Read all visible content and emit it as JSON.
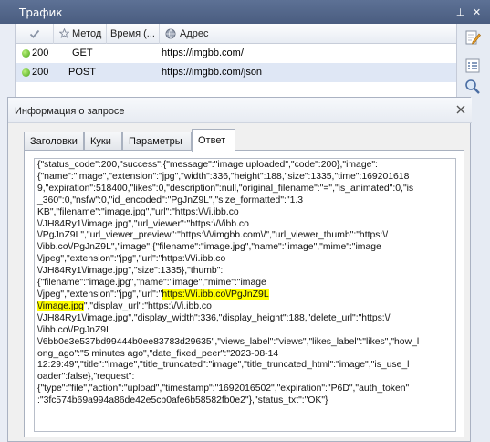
{
  "window": {
    "title": "Трафик",
    "pin_glyph": "⊥",
    "close_glyph": "✕"
  },
  "table": {
    "columns": [
      "",
      "Метод",
      "Время (...",
      "Адрес"
    ],
    "rows": [
      {
        "status": "200",
        "method": "GET",
        "address": "https://imgbb.com/"
      },
      {
        "status": "200",
        "method": "POST",
        "address": "https://imgbb.com/json"
      }
    ]
  },
  "dialog": {
    "title": "Информация о запросе",
    "tabs": [
      "Заголовки",
      "Куки",
      "Параметры",
      "Ответ"
    ],
    "active_tab": "Ответ",
    "response_lines": [
      {
        "t": "{\"status_code\":200,\"success\":{\"message\":\"image uploaded\",\"code\":200},\"image\":"
      },
      {
        "t": "{\"name\":\"image\",\"extension\":\"jpg\",\"width\":336,\"height\":188,\"size\":1335,\"time\":169201618"
      },
      {
        "t": "9,\"expiration\":518400,\"likes\":0,\"description\":null,\"original_filename\":\"=\",\"is_animated\":0,\"is"
      },
      {
        "t": "_360\":0,\"nsfw\":0,\"id_encoded\":\"PgJnZ9L\",\"size_formatted\":\"1.3"
      },
      {
        "t": "KB\",\"filename\":\"image.jpg\",\"url\":\"https:\\/\\/i.ibb.co"
      },
      {
        "t": "\\/JH84Ry1\\/image.jpg\",\"url_viewer\":\"https:\\/\\/ibb.co"
      },
      {
        "t": "\\/PgJnZ9L\",\"url_viewer_preview\":\"https:\\/\\/imgbb.com\\/\",\"url_viewer_thumb\":\"https:\\/"
      },
      {
        "t": "\\/ibb.co\\/PgJnZ9L\",\"image\":{\"filename\":\"image.jpg\",\"name\":\"image\",\"mime\":\"image"
      },
      {
        "t": "\\/jpeg\",\"extension\":\"jpg\",\"url\":\"https:\\/\\/i.ibb.co"
      },
      {
        "t": "\\/JH84Ry1\\/image.jpg\",\"size\":1335},\"thumb\":"
      },
      {
        "t": "{\"filename\":\"image.jpg\",\"name\":\"image\",\"mime\":\"image"
      },
      {
        "t": "\\/jpeg\",\"extension\":\"jpg\",\"url\":\"",
        "h": "https:\\/\\/i.ibb.co\\/PgJnZ9L"
      },
      {
        "h": "\\/image.jpg",
        "t": "\",\"display_url\":\"https:\\/\\/i.ibb.co"
      },
      {
        "t": "\\/JH84Ry1\\/image.jpg\",\"display_width\":336,\"display_height\":188,\"delete_url\":\"https:\\/"
      },
      {
        "t": "\\/ibb.co\\/PgJnZ9L"
      },
      {
        "t": "\\/6bb0e3e537bd99444b0ee83783d29635\",\"views_label\":\"views\",\"likes_label\":\"likes\",\"how_l"
      },
      {
        "t": "ong_ago\":\"5 minutes ago\",\"date_fixed_peer\":\"2023-08-14"
      },
      {
        "t": "12:29:49\",\"title\":\"image\",\"title_truncated\":\"image\",\"title_truncated_html\":\"image\",\"is_use_l"
      },
      {
        "t": "oader\":false},\"request\":"
      },
      {
        "t": "{\"type\":\"file\",\"action\":\"upload\",\"timestamp\":\"1692016502\",\"expiration\":\"P6D\",\"auth_token\""
      },
      {
        "t": ":\"3fc574b69a994a86de42e5cb0afe6b58582fb0e2\"},\"status_txt\":\"OK\"}"
      }
    ]
  },
  "colors": {
    "titlebar": "#4f6389",
    "selected_row": "#dfe7f5",
    "highlight": "#ffff00",
    "status_ok": "#5cb82a"
  },
  "icons": [
    "pin-icon",
    "close-icon",
    "checkmark-icon",
    "star-icon",
    "clock-icon",
    "globe-icon",
    "edit-icon",
    "list-icon",
    "search-icon",
    "dialog-close-icon"
  ]
}
